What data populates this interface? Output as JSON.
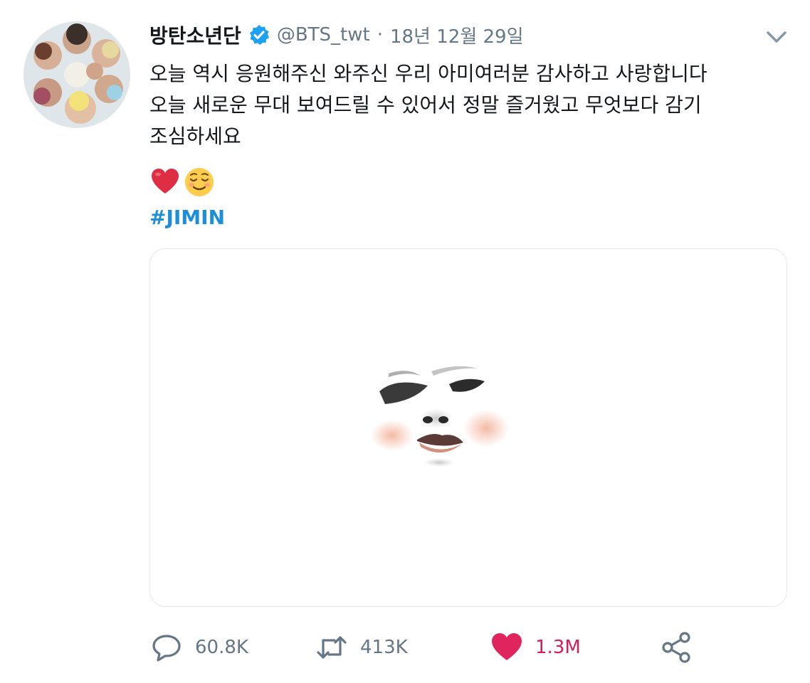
{
  "tweet": {
    "author_name": "방탄소년단",
    "handle": "@BTS_twt",
    "separator": "·",
    "date": "18년 12월 29일",
    "text_lines": [
      "오늘 역시 응원해주신 와주신 우리 아미여러분 감사하고 사랑합니다",
      "오늘 새로운 무대 보여드릴 수 있어서 정말 즐거웠고 무엇보다 감기",
      "조심하세요"
    ],
    "emojis": [
      "heart-emoji",
      "relieved-face-emoji"
    ],
    "hashtag": "#JIMIN"
  },
  "actions": {
    "reply_count": "60.8K",
    "retweet_count": "413K",
    "like_count": "1.3M"
  },
  "colors": {
    "handle_gray": "#657786",
    "hashtag_blue": "#1d8fd8",
    "like_pink": "#d11f5b",
    "verified_blue": "#1da1f2"
  },
  "icons": [
    "verified-badge-icon",
    "chevron-down-icon",
    "reply-icon",
    "retweet-icon",
    "like-heart-icon",
    "share-icon"
  ]
}
